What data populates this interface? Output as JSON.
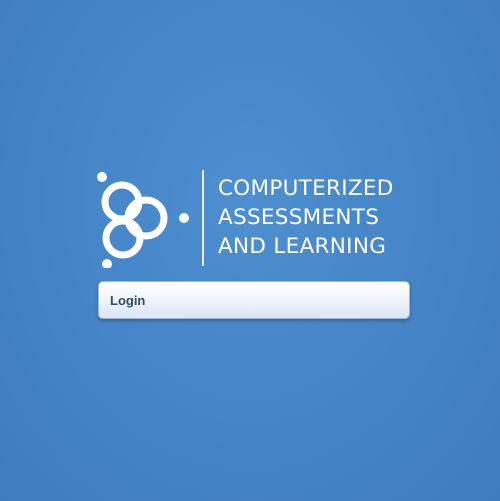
{
  "logo": {
    "icon": "cal-logo-icon",
    "lines": [
      "COMPUTERIZED",
      "ASSESSMENTS",
      "AND LEARNING"
    ]
  },
  "login": {
    "label": "Login"
  },
  "colors": {
    "background": "#4686c9",
    "button_text": "#2b4a6f",
    "logo": "#ffffff"
  }
}
